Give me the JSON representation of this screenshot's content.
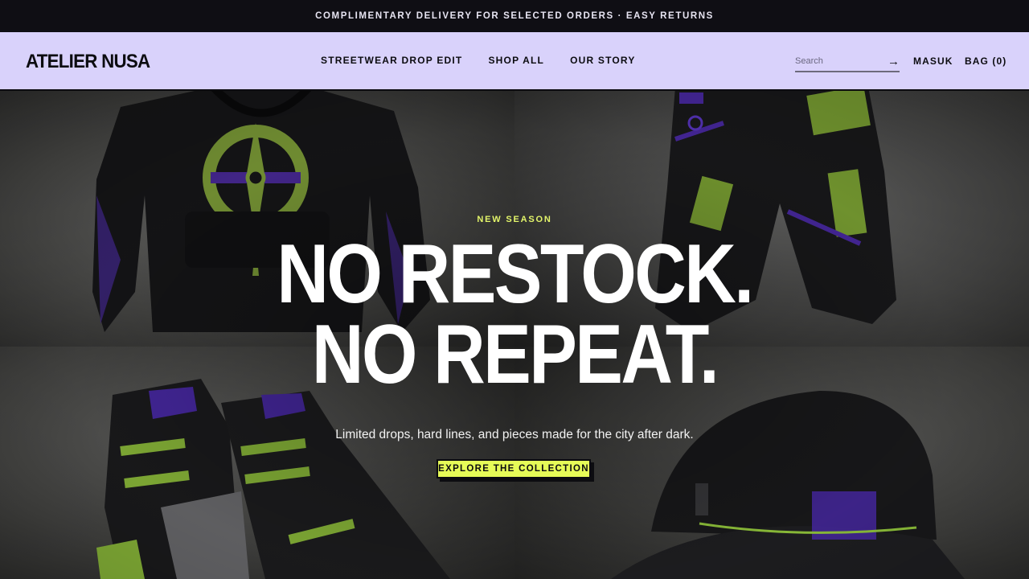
{
  "announcement": "COMPLIMENTARY DELIVERY FOR SELECTED ORDERS · EASY RETURNS",
  "brand": {
    "name": "ATELIER NUSA",
    "colors": {
      "header_bg": "#d9d2fb",
      "accent_lime": "#e6fb57",
      "accent_purple": "#5b2bc9",
      "dark": "#0c0c10"
    }
  },
  "nav": {
    "items": [
      {
        "label": "STREETWEAR DROP EDIT"
      },
      {
        "label": "SHOP ALL"
      },
      {
        "label": "OUR STORY"
      }
    ]
  },
  "search": {
    "placeholder": "Search",
    "value": "",
    "submit_icon": "arrow-right-icon"
  },
  "account": {
    "label": "MASUK"
  },
  "bag": {
    "label": "BAG (0)"
  },
  "hero": {
    "eyebrow": "NEW SEASON",
    "headline_line1": "NO RESTOCK.",
    "headline_line2": "NO REPEAT.",
    "subcopy": "Limited drops, hard lines, and pieces made for the city after dark.",
    "cta_label": "EXPLORE THE COLLECTION"
  }
}
